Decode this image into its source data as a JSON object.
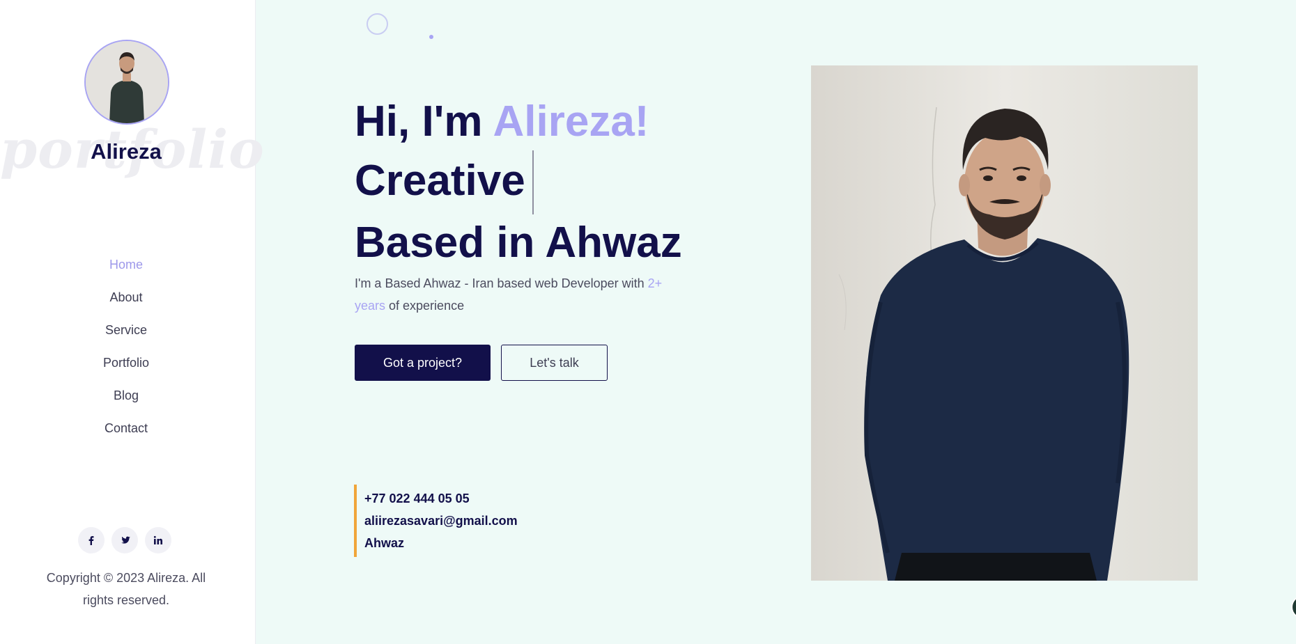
{
  "sidebar": {
    "profile_name": "Alireza",
    "watermark": "portfolio",
    "nav": [
      {
        "label": "Home",
        "active": true
      },
      {
        "label": "About",
        "active": false
      },
      {
        "label": "Service",
        "active": false
      },
      {
        "label": "Portfolio",
        "active": false
      },
      {
        "label": "Blog",
        "active": false
      },
      {
        "label": "Contact",
        "active": false
      }
    ],
    "socials": [
      {
        "icon": "facebook-icon",
        "glyph": "f"
      },
      {
        "icon": "twitter-icon",
        "glyph": "t"
      },
      {
        "icon": "linkedin-icon",
        "glyph": "in"
      }
    ],
    "copyright": "Copyright © 2023 Alireza. All rights reserved."
  },
  "hero": {
    "greeting_prefix": "Hi, I'm ",
    "greeting_name": "Alireza!",
    "line2": "Creative",
    "line3": "Based in Ahwaz",
    "desc_prefix": "I'm a Based Ahwaz - Iran based web Developer with ",
    "desc_highlight": "2+ years",
    "desc_suffix": " of experience",
    "primary_button": "Got a project?",
    "secondary_button": "Let's talk"
  },
  "contact": {
    "phone": "+77 022 444 05 05",
    "email": "aliirezasavari@gmail.com",
    "location": "Ahwaz"
  },
  "colors": {
    "primary": "#12104a",
    "accent": "#a8a4f3",
    "background": "#eefaf7",
    "contact_border": "#f0a53a"
  }
}
